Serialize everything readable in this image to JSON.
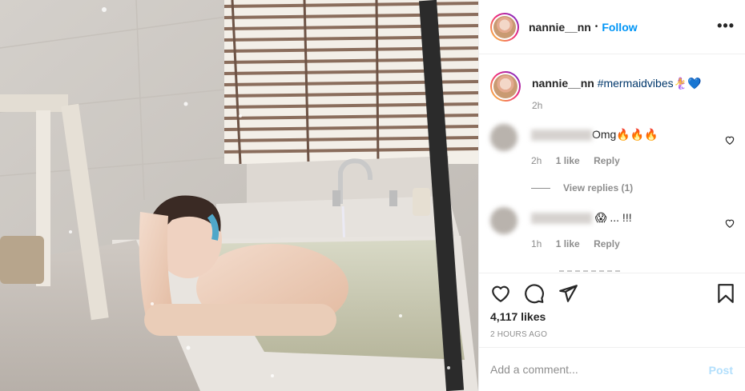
{
  "header": {
    "username": "nannie__nn",
    "separator": "•",
    "follow_label": "Follow",
    "more_label": "•••"
  },
  "caption": {
    "username": "nannie__nn",
    "hashtag": "#mermaidvibes",
    "emoji": "🧜‍♀️💙",
    "time": "2h"
  },
  "comments": [
    {
      "text": "Omg🔥🔥🔥",
      "time": "2h",
      "likes": "1 like",
      "reply_label": "Reply",
      "view_replies": "View replies (1)"
    },
    {
      "text": "😱 ... !!!",
      "time": "1h",
      "likes": "1 like",
      "reply_label": "Reply"
    }
  ],
  "actions": {
    "likes": "4,117 likes",
    "timestamp": "2 HOURS AGO"
  },
  "add_comment": {
    "placeholder": "Add a comment...",
    "post_label": "Post"
  },
  "colors": {
    "accent": "#0095f6",
    "post_disabled": "#b2dffc",
    "hashtag": "#00376b",
    "muted": "#8e8e8e"
  }
}
